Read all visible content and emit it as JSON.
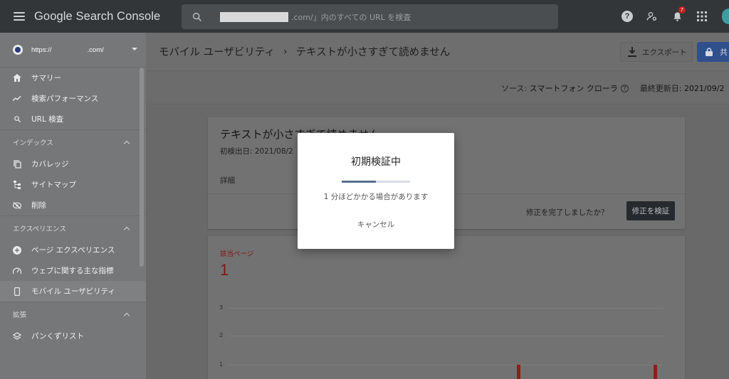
{
  "app": {
    "title": "Google Search Console",
    "search_text": ".com/」内のすべての URL を検査",
    "notification_count": "7",
    "icons": [
      "menu-icon",
      "search-icon",
      "help-icon",
      "manage-accounts-icon",
      "bell-icon",
      "apps-icon"
    ]
  },
  "property": {
    "prefix": "https://",
    "suffix": ".com/"
  },
  "sidebar": {
    "top_items": [
      {
        "label": "サマリー",
        "icon": "home-icon"
      },
      {
        "label": "検索パフォーマンス",
        "icon": "trending-icon"
      },
      {
        "label": "URL 検査",
        "icon": "search-icon"
      }
    ],
    "sections": [
      {
        "title": "インデックス",
        "items": [
          {
            "label": "カバレッジ",
            "icon": "copy-icon"
          },
          {
            "label": "サイトマップ",
            "icon": "sitemap-icon"
          },
          {
            "label": "削除",
            "icon": "visibility-off-icon"
          }
        ]
      },
      {
        "title": "エクスペリエンス",
        "items": [
          {
            "label": "ページ エクスペリエンス",
            "icon": "add-circle-icon"
          },
          {
            "label": "ウェブに関する主な指標",
            "icon": "speed-icon"
          },
          {
            "label": "モバイル ユーザビリティ",
            "icon": "smartphone-icon",
            "active": true
          }
        ]
      },
      {
        "title": "拡張",
        "items": [
          {
            "label": "パンくずリスト",
            "icon": "layers-icon"
          }
        ]
      }
    ]
  },
  "header": {
    "breadcrumb_parent": "モバイル ユーザビリティ",
    "breadcrumb_sep": "›",
    "breadcrumb_current": "テキストが小さすぎて読めません",
    "export_label": "エクスポート",
    "share_label": "共"
  },
  "subbar": {
    "source_label": "ソース:",
    "source_value": "スマートフォン クローラ",
    "updated_label": "最終更新日:",
    "updated_value": "2021/09/2"
  },
  "issue_card": {
    "title": "テキストが小さすぎて読めません",
    "first_detected": "初検出日: 2021/08/2",
    "details_label": "詳細",
    "question": "修正を完了しましたか？",
    "validate_button": "修正を検証"
  },
  "affected_card": {
    "label": "該当ページ",
    "count": "1",
    "y_ticks": [
      "3",
      "2",
      "1"
    ]
  },
  "modal": {
    "title": "初期検証中",
    "progress": 0.5,
    "note": "1 分ほどかかる場合があります",
    "cancel": "キャンセル"
  },
  "colors": {
    "topbar": "#323639",
    "accent_blue": "#1a73e8",
    "error_red": "#c5221f"
  }
}
